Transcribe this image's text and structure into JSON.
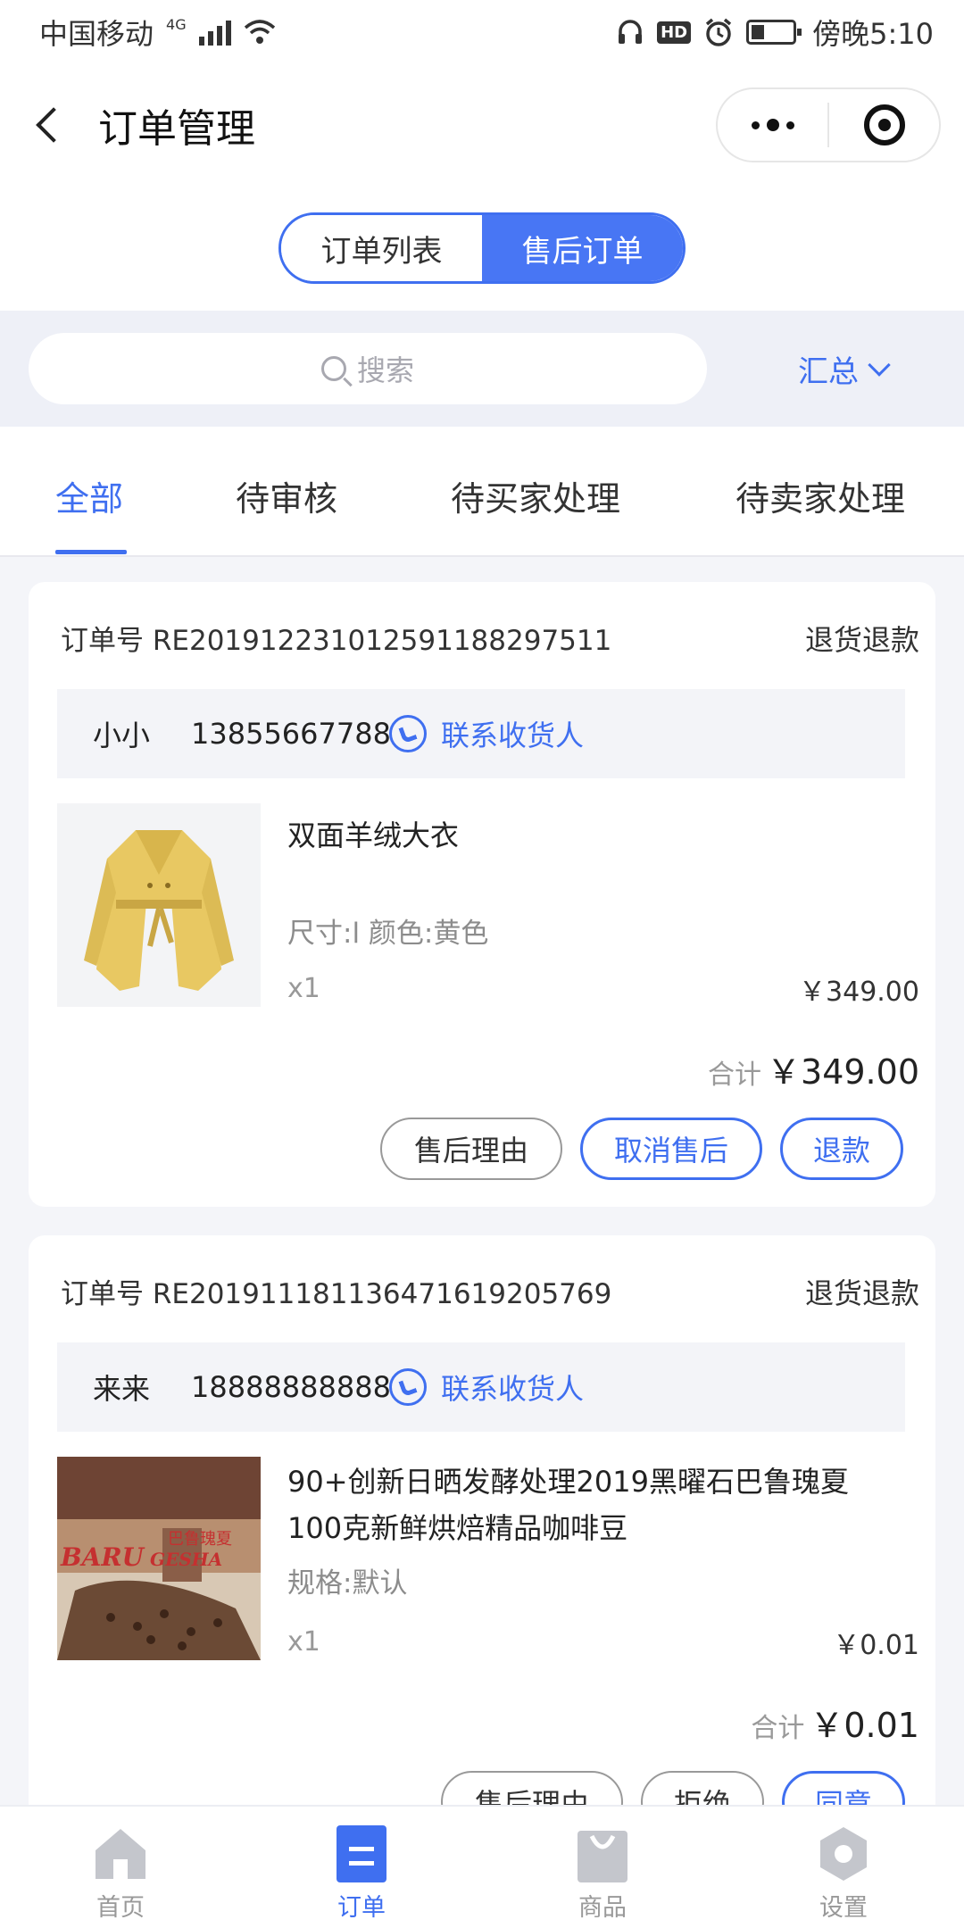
{
  "status_bar": {
    "carrier": "中国移动",
    "network": "4G",
    "time_label": "傍晚5:10",
    "hd_badge": "HD"
  },
  "nav": {
    "title": "订单管理"
  },
  "segment": {
    "options": [
      "订单列表",
      "售后订单"
    ],
    "selected": "售后订单"
  },
  "search": {
    "placeholder": "搜索",
    "summary_label": "汇总"
  },
  "tabs": {
    "items": [
      "全部",
      "待审核",
      "待买家处理",
      "待卖家处理"
    ],
    "selected": "全部"
  },
  "orders": [
    {
      "order_no_label": "订单号 RE20191223101259118829751​1",
      "type": "退货退款",
      "contact_name": "小小",
      "contact_phone": "13855667788",
      "contact_link": "联系收货人",
      "product_name": "双面羊绒大衣",
      "spec": "尺寸:l   颜色:黄色",
      "qty": "x1",
      "price": "￥349.00",
      "total_label": "合计",
      "total_value": "￥349.00",
      "buttons": [
        "售后理由",
        "取消售后",
        "退款"
      ]
    },
    {
      "order_no_label": "订单号 RE20191118113647161920576​9",
      "type": "退货退款",
      "contact_name": "来来",
      "contact_phone": "18888888888",
      "contact_link": "联系收货人",
      "product_name": "90+创新日晒发酵处理2019黑曜石巴鲁瑰夏100克新鲜烘焙精品咖啡豆",
      "spec": "规格:默认",
      "qty": "x1",
      "price": "￥0.01",
      "total_label": "合计",
      "total_value": "￥0.01",
      "image_text": {
        "cn": "巴鲁瑰夏",
        "en1": "BARU",
        "en2": "GESHA"
      },
      "buttons": [
        "售后理由",
        "拒绝",
        "同意"
      ]
    }
  ],
  "tabbar": {
    "items": [
      "首页",
      "订单",
      "商品",
      "设置"
    ],
    "selected": "订单"
  },
  "colors": {
    "accent": "#3f6ff0",
    "page_bg": "#f4f5f9",
    "muted_text": "#999999"
  }
}
